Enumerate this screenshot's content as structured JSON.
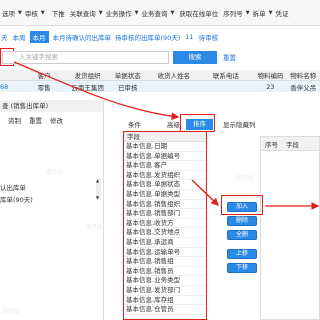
{
  "toolbar": {
    "items": [
      "选项",
      "审核",
      "下推",
      "关联查询",
      "业务操作",
      "业务查询",
      "获取在线单位",
      "序列号",
      "拆单",
      "凭证"
    ]
  },
  "quickfilter": {
    "labels": [
      "天",
      "本周",
      "本月",
      "本月待确认的出库单",
      "待审核的出库单(90天)",
      "11",
      "待审核"
    ]
  },
  "search": {
    "placeholder": "入关键字搜索",
    "button": "搜索",
    "reset": "重置"
  },
  "grid": {
    "headers": [
      "",
      "客户",
      "发货组织",
      "单据状态",
      "收货人姓名",
      "联系电话",
      "物料编码",
      "物料名称"
    ],
    "row": {
      "id": "68",
      "customer": "零售",
      "org": "云南王集团",
      "status": "已审核",
      "consignee": "",
      "phone": "",
      "code": "23",
      "name": "香伴父吊"
    }
  },
  "scheme": {
    "title": "查 (销售出库单)",
    "actions": [
      "资制",
      "重置",
      "修改"
    ],
    "items": [
      "认出库单",
      "库单(90天)"
    ]
  },
  "dialog": {
    "tabs": [
      "条件",
      "高级",
      "排序",
      "显示隐藏列"
    ],
    "field_header": "字段",
    "fields": [
      "基本信息.日期",
      "基本信息.单据编号",
      "基本信息.客户",
      "基本信息.发货组织",
      "基本信息.单据状态",
      "基本信息.单据类型",
      "基本信息.销售组织",
      "基本信息.销售部门",
      "基本信息.收货方",
      "基本信息.交货地点",
      "基本信息.承运商",
      "基本信息.运输单号",
      "基本信息.销售组",
      "基本信息.销售员",
      "基本信息.业务类型",
      "基本信息.发货部门",
      "基本信息.库存组",
      "基本信息.仓管员"
    ],
    "right_headers": [
      "序号",
      "字段"
    ],
    "buttons": [
      "加入",
      "删除",
      "全删",
      "上移",
      "下移"
    ]
  },
  "watermark": "演示版"
}
